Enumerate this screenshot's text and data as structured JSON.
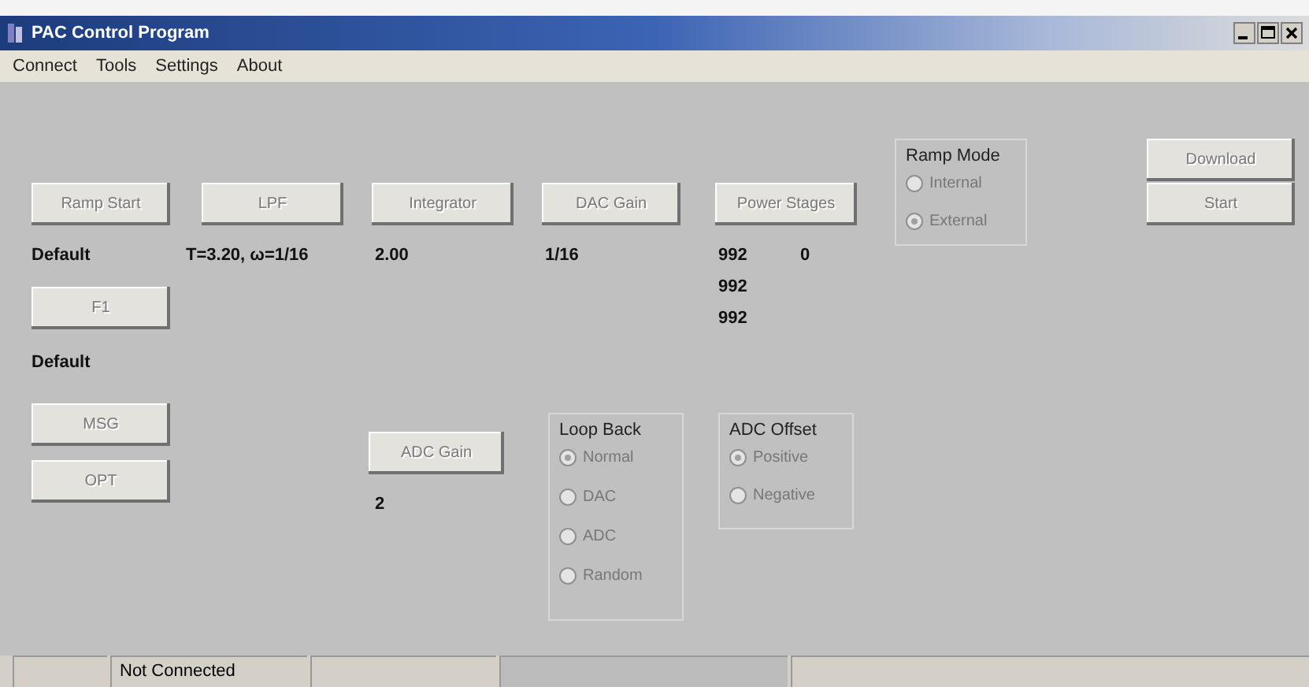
{
  "window": {
    "title": "PAC Control Program"
  },
  "menu": [
    "Connect",
    "Tools",
    "Settings",
    "About"
  ],
  "buttons": [
    {
      "label": "Ramp Start",
      "disabled": true
    },
    {
      "label": "LPF",
      "disabled": true
    },
    {
      "label": "Integrator",
      "disabled": true
    },
    {
      "label": "DAC Gain",
      "disabled": true
    },
    {
      "label": "Power Stages",
      "disabled": true
    },
    {
      "label": "Download",
      "disabled": true
    },
    {
      "label": "Start",
      "disabled": true
    },
    {
      "label": "F1",
      "disabled": true
    },
    {
      "label": "MSG",
      "disabled": true
    },
    {
      "label": "OPT",
      "disabled": true
    },
    {
      "label": "ADC Gain",
      "disabled": true
    }
  ],
  "values": [
    "Default",
    "T=3.20, ω=1/16",
    "2.00",
    "1/16",
    "992",
    "0",
    "992",
    "992",
    "Default",
    "2"
  ],
  "groups": [
    {
      "title": "Ramp Mode",
      "options": [
        {
          "label": "Internal",
          "selected": false
        },
        {
          "label": "External",
          "selected": true
        }
      ]
    },
    {
      "title": "Loop Back",
      "options": [
        {
          "label": "Normal",
          "selected": true
        },
        {
          "label": "DAC",
          "selected": false
        },
        {
          "label": "ADC",
          "selected": false
        },
        {
          "label": "Random",
          "selected": false
        }
      ]
    },
    {
      "title": "ADC Offset",
      "options": [
        {
          "label": "Positive",
          "selected": true
        },
        {
          "label": "Negative",
          "selected": false
        }
      ]
    }
  ],
  "status_bar": [
    "Not Connected"
  ]
}
